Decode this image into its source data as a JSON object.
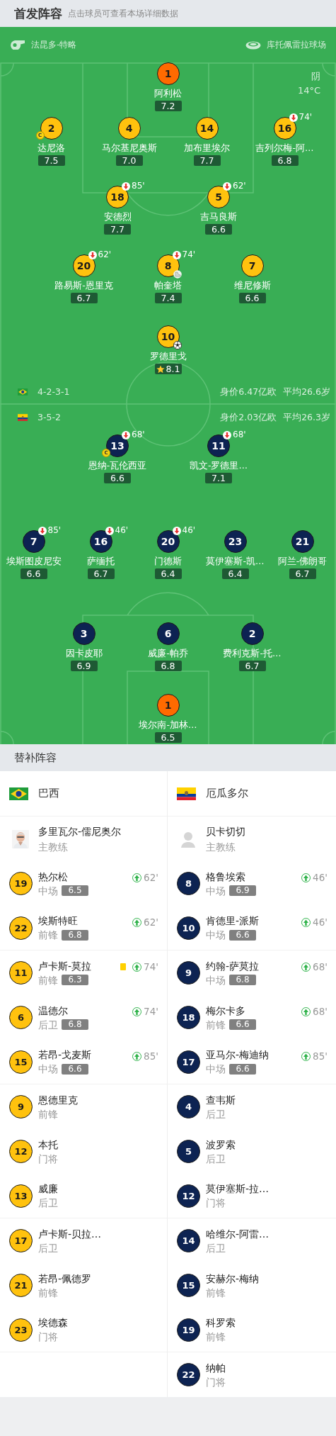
{
  "header": {
    "title": "首发阵容",
    "hint": "点击球员可查看本场详细数据"
  },
  "match_info": {
    "referee": "法昆多-特略",
    "stadium": "库托佩雷拉球场",
    "weather": "阴",
    "temperature": "14°C"
  },
  "teams": [
    {
      "kind": "home",
      "flag": {
        "kind": "br"
      },
      "color": "#ffc20e",
      "formation": "4-2-3-1",
      "value": "身价6.47亿欧",
      "age": "平均26.6岁",
      "rows": [
        {
          "kind": "goalkeeper",
          "players": [
            {
              "number": "1",
              "name": "阿利松",
              "rating": "7.2"
            }
          ]
        },
        {
          "kind": "outfield",
          "players": [
            {
              "number": "2",
              "name": "达尼洛",
              "rating": "7.5",
              "captain": "C"
            },
            {
              "number": "4",
              "name": "马尔基尼奥斯",
              "rating": "7.0"
            },
            {
              "number": "14",
              "name": "加布里埃尔",
              "rating": "7.7"
            },
            {
              "number": "16",
              "name": "吉列尔梅-阿…",
              "rating": "6.8",
              "sub_off": "74'"
            }
          ]
        },
        {
          "kind": "outfield",
          "players": [
            {
              "number": "18",
              "name": "安德烈",
              "rating": "7.7",
              "sub_off": "85'"
            },
            {
              "number": "5",
              "name": "吉马良斯",
              "rating": "6.6",
              "sub_off": "62'"
            }
          ]
        },
        {
          "kind": "outfield",
          "players": [
            {
              "number": "20",
              "name": "路易斯-恩里克",
              "rating": "6.7",
              "sub_off": "62'"
            },
            {
              "number": "8",
              "name": "帕奎塔",
              "rating": "7.4",
              "sub_off": "74'",
              "event": {
                "kind": "assist"
              }
            },
            {
              "number": "7",
              "name": "维尼修斯",
              "rating": "6.6"
            }
          ]
        },
        {
          "kind": "outfield",
          "players": [
            {
              "number": "10",
              "name": "罗德里戈",
              "rating": "8.1",
              "event": {
                "kind": "goal"
              },
              "best": true
            }
          ]
        }
      ]
    },
    {
      "kind": "away",
      "flag": {
        "kind": "ec"
      },
      "color": "#0d2352",
      "formation": "3-5-2",
      "value": "身价2.03亿欧",
      "age": "平均26.3岁",
      "rows": [
        {
          "kind": "outfield",
          "players": [
            {
              "number": "13",
              "name": "恩纳-瓦伦西亚",
              "rating": "6.6",
              "sub_off": "68'",
              "captain": "C"
            },
            {
              "number": "11",
              "name": "凯文-罗德里…",
              "rating": "7.1",
              "sub_off": "68'"
            }
          ]
        },
        {
          "kind": "outfield",
          "players": [
            {
              "number": "7",
              "name": "埃斯图皮尼安",
              "rating": "6.6",
              "sub_off": "85'"
            },
            {
              "number": "16",
              "name": "萨缅托",
              "rating": "6.7",
              "sub_off": "46'"
            },
            {
              "number": "20",
              "name": "门德斯",
              "rating": "6.4",
              "sub_off": "46'"
            },
            {
              "number": "23",
              "name": "莫伊塞斯-凯…",
              "rating": "6.4"
            },
            {
              "number": "21",
              "name": "阿兰-佛朗哥",
              "rating": "6.7"
            }
          ]
        },
        {
          "kind": "outfield",
          "players": [
            {
              "number": "3",
              "name": "因卡皮耶",
              "rating": "6.9"
            },
            {
              "number": "6",
              "name": "威廉-帕乔",
              "rating": "6.8"
            },
            {
              "number": "2",
              "name": "费利克斯-托…",
              "rating": "6.7"
            }
          ]
        },
        {
          "kind": "goalkeeper",
          "players": [
            {
              "number": "1",
              "name": "埃尔南-加林…",
              "rating": "6.5"
            }
          ]
        }
      ]
    }
  ],
  "bench": {
    "title": "替补阵容",
    "teams": [
      {
        "name": "巴西",
        "coach": {
          "name": "多里瓦尔-儒尼奥尔",
          "role": "主教练",
          "photo": true
        },
        "substitutes": [
          {
            "number": "19",
            "name": "热尔松",
            "position": "中场",
            "rating": "6.5",
            "sub_on": "62'"
          },
          {
            "number": "22",
            "name": "埃斯特旺",
            "position": "前锋",
            "rating": "6.8",
            "sub_on": "62'"
          },
          {
            "number": "11",
            "name": "卢卡斯-莫拉",
            "position": "前锋",
            "rating": "6.3",
            "sub_on": "74'",
            "yellow_card": true
          },
          {
            "number": "6",
            "name": "温德尔",
            "position": "后卫",
            "rating": "6.8",
            "sub_on": "74'"
          },
          {
            "number": "15",
            "name": "若昂-戈麦斯",
            "position": "中场",
            "rating": "6.6",
            "sub_on": "85'"
          },
          {
            "number": "9",
            "name": "恩德里克",
            "position": "前锋"
          },
          {
            "number": "12",
            "name": "本托",
            "position": "门将"
          },
          {
            "number": "13",
            "name": "威廉",
            "position": "后卫"
          },
          {
            "number": "17",
            "name": "卢卡斯-贝拉…",
            "position": "后卫"
          },
          {
            "number": "21",
            "name": "若昂-佩德罗",
            "position": "前锋"
          },
          {
            "number": "23",
            "name": "埃德森",
            "position": "门将"
          }
        ]
      },
      {
        "name": "厄瓜多尔",
        "coach": {
          "name": "贝卡切切",
          "role": "主教练",
          "photo": false
        },
        "substitutes": [
          {
            "number": "8",
            "name": "格鲁埃索",
            "position": "中场",
            "rating": "6.9",
            "sub_on": "46'"
          },
          {
            "number": "10",
            "name": "肯德里-派斯",
            "position": "中场",
            "rating": "6.6",
            "sub_on": "46'"
          },
          {
            "number": "9",
            "name": "约翰-萨莫拉",
            "position": "中场",
            "rating": "6.8",
            "sub_on": "68'"
          },
          {
            "number": "18",
            "name": "梅尔卡多",
            "position": "前锋",
            "rating": "6.6",
            "sub_on": "68'"
          },
          {
            "number": "17",
            "name": "亚马尔-梅迪纳",
            "position": "中场",
            "rating": "6.6",
            "sub_on": "85'"
          },
          {
            "number": "4",
            "name": "查韦斯",
            "position": "后卫"
          },
          {
            "number": "5",
            "name": "波罗索",
            "position": "后卫"
          },
          {
            "number": "12",
            "name": "莫伊塞斯-拉…",
            "position": "门将"
          },
          {
            "number": "14",
            "name": "哈维尔-阿雷…",
            "position": "后卫"
          },
          {
            "number": "15",
            "name": "安赫尔-梅纳",
            "position": "前锋"
          },
          {
            "number": "19",
            "name": "科罗索",
            "position": "前锋"
          },
          {
            "number": "22",
            "name": "纳帕",
            "position": "门将"
          }
        ]
      }
    ]
  }
}
